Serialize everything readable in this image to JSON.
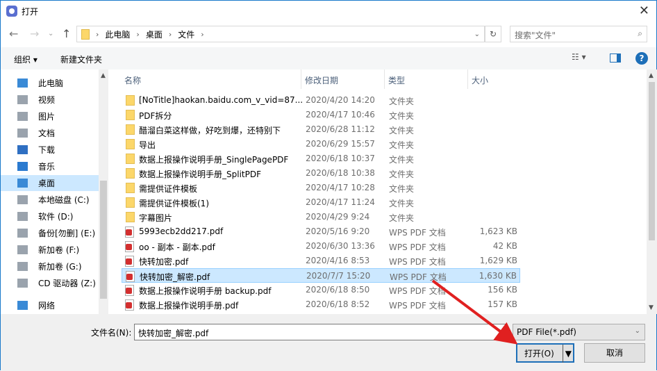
{
  "title": "打开",
  "breadcrumb": [
    "此电脑",
    "桌面",
    "文件"
  ],
  "search_placeholder": "搜索\"文件\"",
  "toolbar": {
    "organize": "组织 ▾",
    "new_folder": "新建文件夹"
  },
  "sidebar": [
    "此电脑",
    "视频",
    "图片",
    "文档",
    "下载",
    "音乐",
    "桌面",
    "本地磁盘 (C:)",
    "软件 (D:)",
    "备份[勿删] (E:)",
    "新加卷 (F:)",
    "新加卷 (G:)",
    "CD 驱动器 (Z:)",
    "网络"
  ],
  "columns": [
    "名称",
    "修改日期",
    "类型",
    "大小"
  ],
  "files": [
    {
      "name": "[NoTitle]haokan.baidu.com_v_vid=87...",
      "date": "2020/4/20 14:20",
      "type": "文件夹",
      "size": "",
      "kind": "folder"
    },
    {
      "name": "PDF拆分",
      "date": "2020/4/17 10:46",
      "type": "文件夹",
      "size": "",
      "kind": "folder"
    },
    {
      "name": "醋溜白菜这样做，好吃到爆，还特别下",
      "date": "2020/6/28 11:12",
      "type": "文件夹",
      "size": "",
      "kind": "folder"
    },
    {
      "name": "导出",
      "date": "2020/6/29 15:57",
      "type": "文件夹",
      "size": "",
      "kind": "folder"
    },
    {
      "name": "数据上报操作说明手册_SinglePagePDF",
      "date": "2020/6/18 10:37",
      "type": "文件夹",
      "size": "",
      "kind": "folder"
    },
    {
      "name": "数据上报操作说明手册_SplitPDF",
      "date": "2020/6/18 10:38",
      "type": "文件夹",
      "size": "",
      "kind": "folder"
    },
    {
      "name": "需提供证件模板",
      "date": "2020/4/17 10:28",
      "type": "文件夹",
      "size": "",
      "kind": "folder"
    },
    {
      "name": "需提供证件模板(1)",
      "date": "2020/4/17 11:24",
      "type": "文件夹",
      "size": "",
      "kind": "folder"
    },
    {
      "name": "字幕图片",
      "date": "2020/4/29 9:24",
      "type": "文件夹",
      "size": "",
      "kind": "folder"
    },
    {
      "name": "5993ecb2dd217.pdf",
      "date": "2020/5/16 9:20",
      "type": "WPS PDF 文档",
      "size": "1,623 KB",
      "kind": "pdf"
    },
    {
      "name": "oo - 副本 - 副本.pdf",
      "date": "2020/6/30 13:36",
      "type": "WPS PDF 文档",
      "size": "42 KB",
      "kind": "pdf"
    },
    {
      "name": "快转加密.pdf",
      "date": "2020/4/16 8:53",
      "type": "WPS PDF 文档",
      "size": "1,629 KB",
      "kind": "pdf"
    },
    {
      "name": "快转加密_解密.pdf",
      "date": "2020/7/7 15:20",
      "type": "WPS PDF 文档",
      "size": "1,630 KB",
      "kind": "pdf",
      "selected": true
    },
    {
      "name": "数据上报操作说明手册 backup.pdf",
      "date": "2020/6/18 8:50",
      "type": "WPS PDF 文档",
      "size": "156 KB",
      "kind": "pdf"
    },
    {
      "name": "数据上报操作说明手册.pdf",
      "date": "2020/6/18 8:52",
      "type": "WPS PDF 文档",
      "size": "157 KB",
      "kind": "pdf"
    }
  ],
  "filename_label": "文件名(N):",
  "filename_value": "快转加密_解密.pdf",
  "filter": "PDF File(*.pdf)",
  "open_label": "打开(O)",
  "cancel_label": "取消"
}
